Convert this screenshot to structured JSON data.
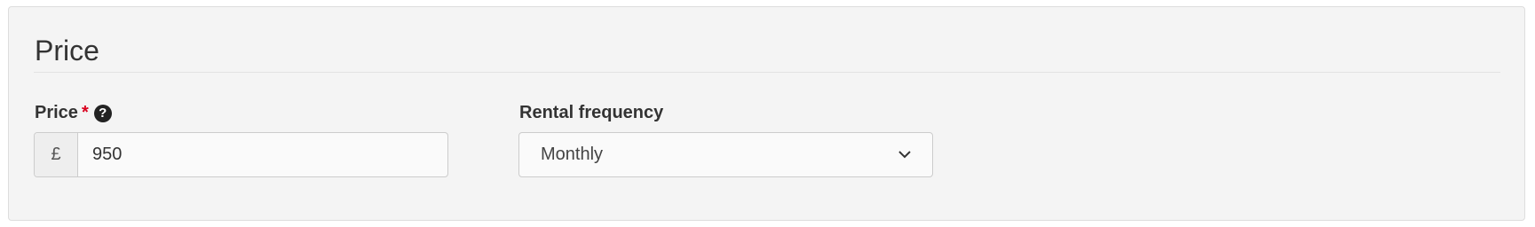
{
  "section": {
    "title": "Price"
  },
  "price_field": {
    "label": "Price",
    "required_mark": "*",
    "help_icon": "question-circle-icon",
    "currency_symbol": "£",
    "value": "950"
  },
  "rental_frequency": {
    "label": "Rental frequency",
    "selected": "Monthly",
    "icon": "chevron-down-icon"
  },
  "colors": {
    "panel_background": "#f4f4f4",
    "required": "#d9001e",
    "text": "#333333"
  }
}
